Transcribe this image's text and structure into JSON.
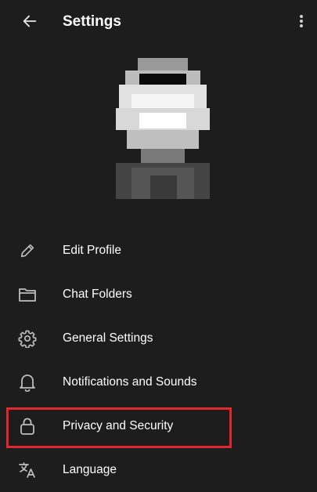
{
  "header": {
    "title": "Settings",
    "back_icon": "arrow-left-icon",
    "more_icon": "more-vertical-icon"
  },
  "menu": {
    "items": [
      {
        "label": "Edit Profile",
        "icon": "pencil-icon"
      },
      {
        "label": "Chat Folders",
        "icon": "folder-icon"
      },
      {
        "label": "General Settings",
        "icon": "gear-icon"
      },
      {
        "label": "Notifications and Sounds",
        "icon": "bell-icon"
      },
      {
        "label": "Privacy and Security",
        "icon": "lock-icon"
      },
      {
        "label": "Language",
        "icon": "translate-icon"
      }
    ]
  },
  "highlight": {
    "color": "#e0282e"
  }
}
